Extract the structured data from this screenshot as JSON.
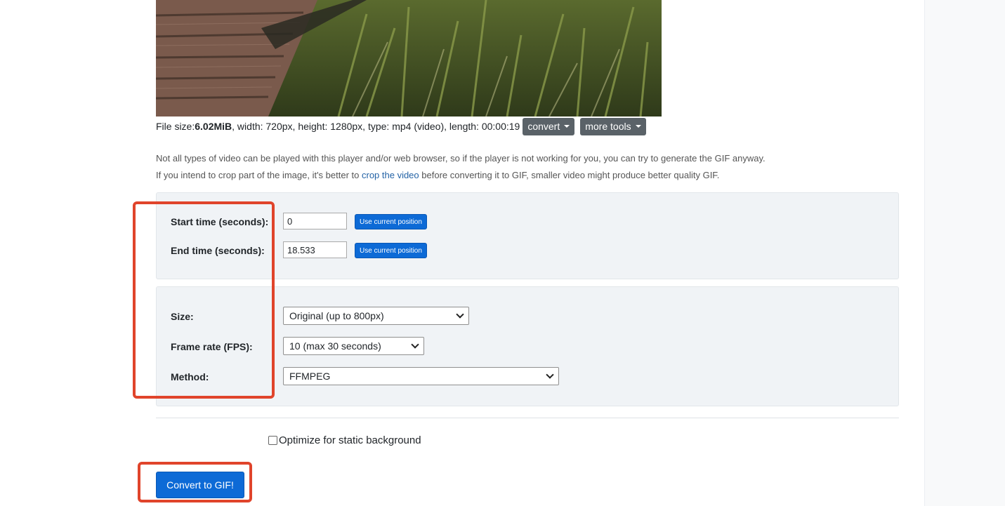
{
  "file_info": {
    "prefix": "File size: ",
    "size": "6.02MiB",
    "details": ", width: 720px, height: 1280px, type: mp4 (video), length: 00:00:19",
    "convert_label": "convert",
    "more_tools_label": "more tools"
  },
  "notes": {
    "line1": "Not all types of video can be played with this player and/or web browser, so if the player is not working for you, you can try to generate the GIF anyway.",
    "line2_before": "If you intend to crop part of the image, it's better to ",
    "line2_link": "crop the video",
    "line2_after": " before converting it to GIF, smaller video might produce better quality GIF."
  },
  "timing": {
    "start_label": "Start time (seconds):",
    "start_value": "0",
    "end_label": "End time (seconds):",
    "end_value": "18.533",
    "use_position_label": "Use current position"
  },
  "options": {
    "size_label": "Size:",
    "size_value": "Original (up to 800px)",
    "fps_label": "Frame rate (FPS):",
    "fps_value": "10 (max 30 seconds)",
    "method_label": "Method:",
    "method_value": "FFMPEG"
  },
  "optimize_label": "Optimize for static background",
  "convert_button": "Convert to GIF!",
  "colors": {
    "primary": "#0d6ad6",
    "highlight": "#e0442b",
    "panel_bg": "#f0f3f6"
  }
}
